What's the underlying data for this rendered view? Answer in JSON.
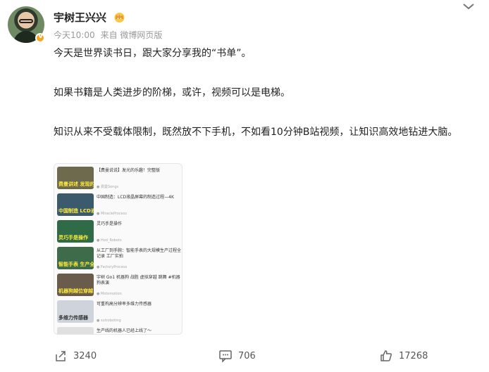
{
  "post": {
    "author": "宇树王兴兴",
    "time": "今天10:00",
    "source": "来自 微博网页版",
    "paragraphs": [
      "今天是世界读书日，跟大家分享我的“书单”。",
      "如果书籍是人类进步的阶梯，或许，视频可以是电梯。",
      "知识从来不受载体限制，既然放不下手机，不如看10分钟B站视频，让知识高效地钻进大脑。"
    ]
  },
  "card_items": [
    {
      "title": "【费曼说说】发光的乐趣！完整版",
      "meta": "● 费曼Songs",
      "cap": "费曼讲述 发现的乐趣",
      "color": "#6d6a4e"
    },
    {
      "title": "中国制造：LCD液晶屏幕的制造过程—4K",
      "meta": "● MiracleProcess",
      "cap": "中国制造 LCD液晶屏",
      "color": "#3b5a6b"
    },
    {
      "title": "灵巧手是操作",
      "meta": "● Hod_Robots",
      "cap": "灵巧手是操作",
      "color": "#2f6b46"
    },
    {
      "title": "从工厂到手腕：智能手表的大规模生产过程全记录 工厂实拍",
      "meta": "● FactoryProcess",
      "cap": "智能手表 生产全过程",
      "color": "#3e6b4a"
    },
    {
      "title": "宇树 Go1 机器狗 战胜 虚拟穿越 跳舞 #机器狗表演",
      "meta": "● Motomotion",
      "cap": "机器狗越位穿越",
      "color": "#6a5c4a"
    },
    {
      "title": "可重构高分辨率多维力传感器",
      "meta": "● sutroboting",
      "cap": "多维力传感器",
      "color": "#cfd4dc"
    },
    {
      "title": "生产线的机器人已经上线了～",
      "meta": "",
      "cap": "",
      "color": "#e0e0e0"
    }
  ],
  "actions": {
    "share_count": "3240",
    "comment_count": "706",
    "like_count": "17268"
  },
  "colors": {
    "accent": "#f5a623",
    "text": "#222222",
    "meta": "#999999"
  },
  "icons": [
    "avatar",
    "verified-badge-icon",
    "crown-icon",
    "chevron-down-icon",
    "share-icon",
    "comment-icon",
    "like-icon"
  ]
}
